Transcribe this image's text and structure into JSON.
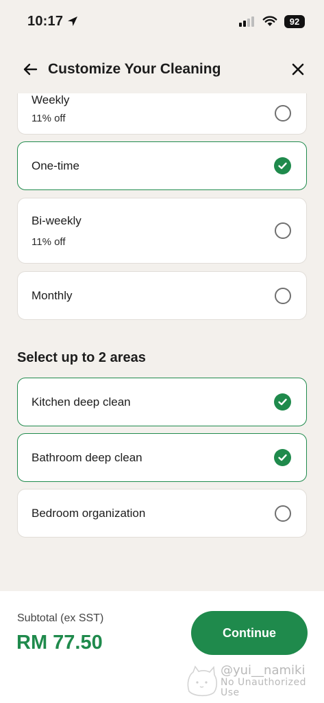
{
  "status_bar": {
    "time": "10:17",
    "battery": "92"
  },
  "header": {
    "title": "Customize Your Cleaning"
  },
  "frequency_options": [
    {
      "label": "Weekly",
      "sub": "11% off",
      "selected": false
    },
    {
      "label": "One-time",
      "sub": "",
      "selected": true
    },
    {
      "label": "Bi-weekly",
      "sub": "11% off",
      "selected": false
    },
    {
      "label": "Monthly",
      "sub": "",
      "selected": false
    }
  ],
  "areas": {
    "title": "Select up to 2 areas",
    "options": [
      {
        "label": "Kitchen deep clean",
        "selected": true
      },
      {
        "label": "Bathroom deep clean",
        "selected": true
      },
      {
        "label": "Bedroom organization",
        "selected": false
      }
    ]
  },
  "footer": {
    "subtotal_label": "Subtotal (ex SST)",
    "subtotal_value": "RM 77.50",
    "continue_label": "Continue"
  },
  "watermark": {
    "line1": "@yui__namiki",
    "line2": "No Unauthorized Use"
  },
  "colors": {
    "accent": "#1f8a4c",
    "background": "#f3f0ec"
  }
}
